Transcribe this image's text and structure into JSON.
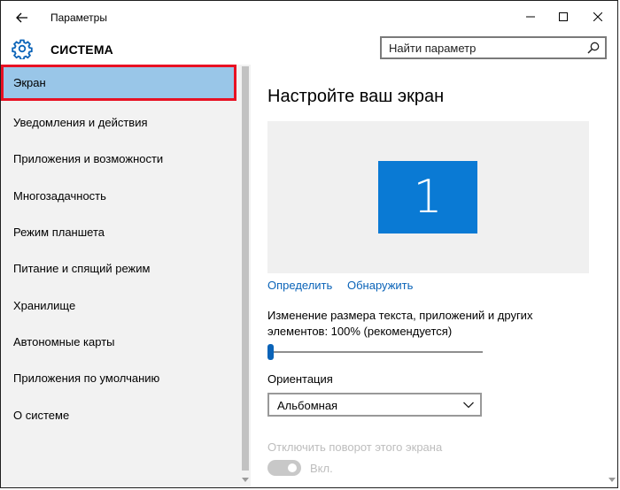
{
  "window": {
    "title": "Параметры",
    "controls": {
      "back": "arrow-left-icon",
      "minimize": "minimize-icon",
      "maximize": "maximize-icon",
      "close": "close-icon"
    }
  },
  "header": {
    "title": "СИСТЕМА",
    "icon": "gear-icon",
    "search": {
      "placeholder": "Найти параметр",
      "value": "",
      "icon": "search-icon"
    }
  },
  "sidebar": {
    "items": [
      {
        "label": "Экран",
        "active": true
      },
      {
        "label": "Уведомления и действия"
      },
      {
        "label": "Приложения и возможности"
      },
      {
        "label": "Многозадачность"
      },
      {
        "label": "Режим планшета"
      },
      {
        "label": "Питание и спящий режим"
      },
      {
        "label": "Хранилище"
      },
      {
        "label": "Автономные карты"
      },
      {
        "label": "Приложения по умолчанию"
      },
      {
        "label": "О системе"
      }
    ]
  },
  "main": {
    "title": "Настройте ваш экран",
    "monitor_label": "1",
    "links": {
      "identify": "Определить",
      "detect": "Обнаружить"
    },
    "scale_label": "Изменение размера текста, приложений и других элементов: 100% (рекомендуется)",
    "scale_slider_fraction": 0.0,
    "orientation": {
      "label": "Ориентация",
      "value": "Альбомная"
    },
    "rotation_lock": {
      "label": "Отключить поворот этого экрана",
      "state": "Вкл.",
      "enabled": false
    }
  },
  "colors": {
    "accent": "#0a7ad4",
    "link": "#0a63b8",
    "selection": "#99c6e8",
    "highlight_border": "#e81123",
    "sidebar_bg": "#f2f2f2"
  }
}
